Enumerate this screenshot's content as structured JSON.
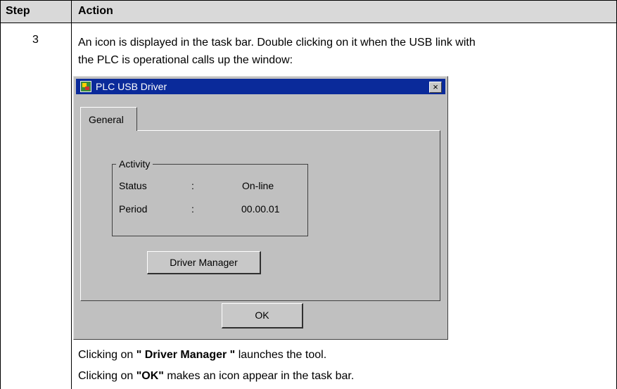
{
  "table": {
    "header_step": "Step",
    "header_action": "Action",
    "step": "3",
    "intro_line1": "An icon is displayed in the task bar. Double clicking on it when the USB link with",
    "intro_line2": "the PLC is operational calls up the window:",
    "footer1_pre": "Clicking on ",
    "footer1_bold": "\" Driver Manager \"",
    "footer1_post": " launches the tool.",
    "footer2_pre": "Clicking on ",
    "footer2_bold": "\"OK\"",
    "footer2_post": " makes an icon appear in the task bar."
  },
  "dialog": {
    "title": "PLC USB Driver",
    "close_glyph": "×",
    "icons": {
      "app": "plc-usb-driver-icon",
      "close": "close-icon"
    },
    "tab_label": "General",
    "group_label": "Activity",
    "status_label": "Status",
    "status_sep": ":",
    "status_value": "On-line",
    "period_label": "Period",
    "period_sep": ":",
    "period_value": "00.00.01",
    "driver_manager_button": "Driver Manager",
    "ok_button": "OK"
  },
  "colors": {
    "header_bg": "#d9d9d9",
    "titlebar": "#0a2a9a",
    "dialog_bg": "#c0c0c0"
  }
}
